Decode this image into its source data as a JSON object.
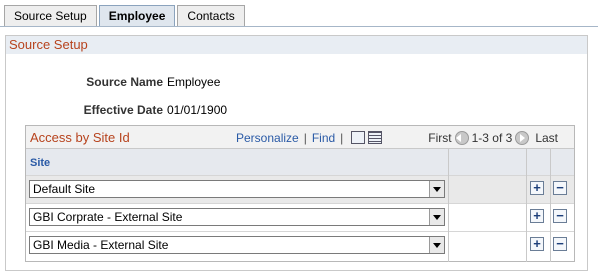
{
  "tabs": [
    {
      "label": "Source Setup",
      "active": false
    },
    {
      "label": "Employee",
      "active": true
    },
    {
      "label": "Contacts",
      "active": false
    }
  ],
  "group": {
    "title": "Source Setup",
    "fields": [
      {
        "label": "Source Name",
        "value": "Employee"
      },
      {
        "label": "Effective Date",
        "value": "01/01/1900"
      }
    ]
  },
  "grid": {
    "title": "Access by Site Id",
    "personalize": "Personalize",
    "find": "Find",
    "first": "First",
    "range": "1-3 of 3",
    "last": "Last",
    "column_site": "Site",
    "rows": [
      {
        "site": "Default Site"
      },
      {
        "site": "GBI Corprate - External Site"
      },
      {
        "site": "GBI Media - External Site"
      }
    ],
    "add_label": "+",
    "delete_label": "−"
  }
}
